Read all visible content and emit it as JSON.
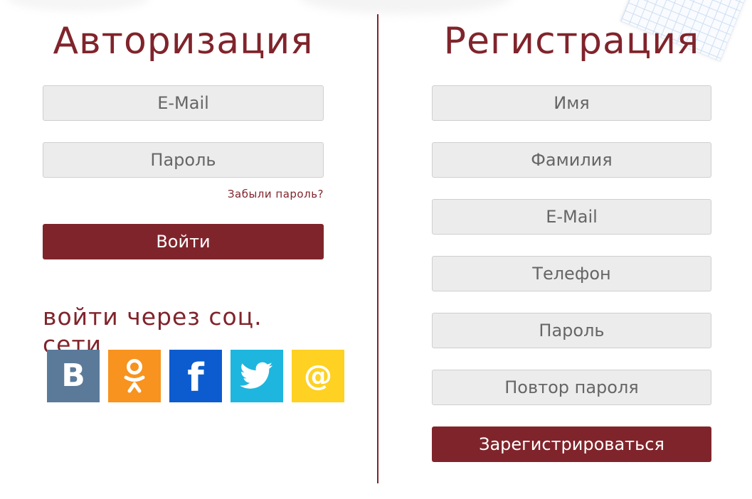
{
  "login": {
    "title": "Авторизация",
    "email_placeholder": "E-Mail",
    "password_placeholder": "Пароль",
    "forgot_link": "Забыли пароль?",
    "submit_label": "Войти",
    "social_title": "войти через соц. сети",
    "social": [
      {
        "name": "vk",
        "icon": "vk-icon",
        "color": "#5b7a99"
      },
      {
        "name": "odnoklassniki",
        "icon": "odnoklassniki-icon",
        "color": "#f7931e"
      },
      {
        "name": "facebook",
        "icon": "facebook-icon",
        "color": "#0d5ccf"
      },
      {
        "name": "twitter",
        "icon": "twitter-bird-icon",
        "color": "#1eb6de"
      },
      {
        "name": "mail",
        "icon": "mail-at-icon",
        "color": "#fed123"
      }
    ]
  },
  "register": {
    "title": "Регистрация",
    "first_name_placeholder": "Имя",
    "last_name_placeholder": "Фамилия",
    "email_placeholder": "E-Mail",
    "phone_placeholder": "Телефон",
    "password_placeholder": "Пароль",
    "password_repeat_placeholder": "Повтор пароля",
    "submit_label": "Зарегистрироваться"
  },
  "colors": {
    "accent": "#80242b",
    "field_bg": "#ececec",
    "field_border": "#cfcfcf"
  }
}
